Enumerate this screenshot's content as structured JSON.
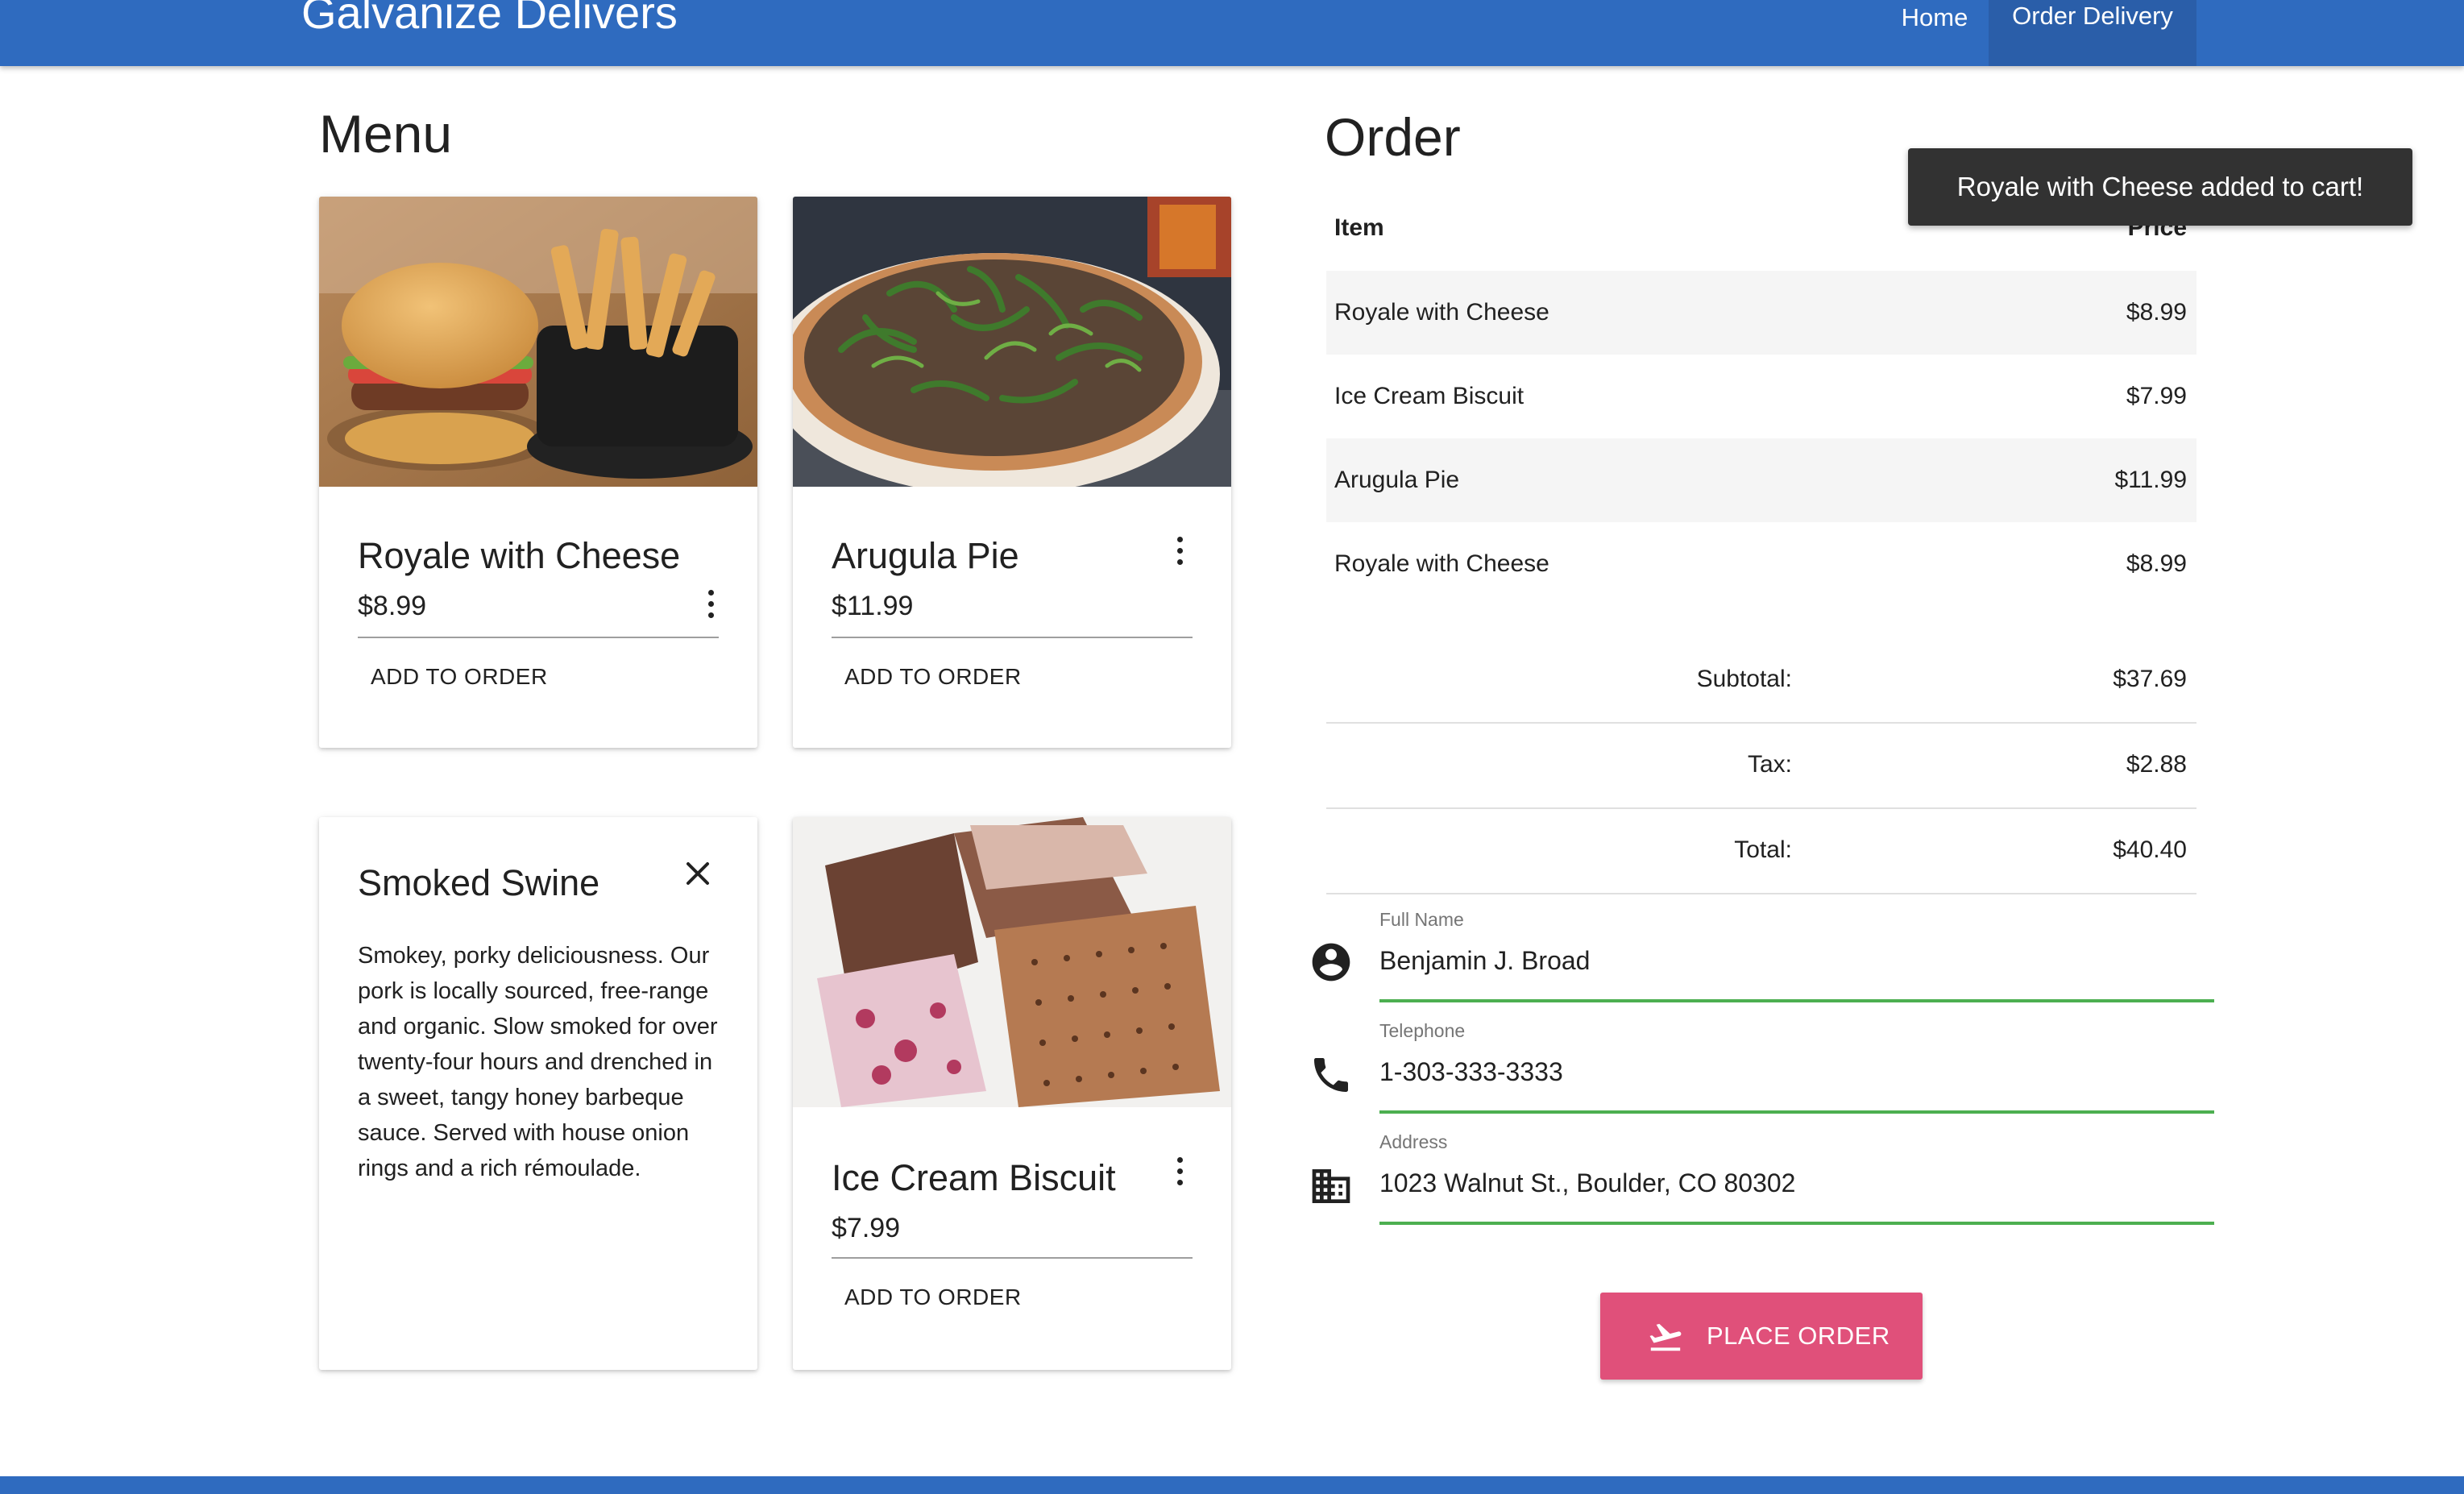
{
  "header": {
    "brand": "Galvanize Delivers",
    "nav": [
      {
        "label": "Home"
      },
      {
        "label": "Order Delivery"
      }
    ],
    "accent_color": "#2f6bbf"
  },
  "menu": {
    "title": "Menu",
    "items": [
      {
        "name": "Royale with Cheese",
        "price": "$8.99",
        "action": "ADD TO ORDER",
        "image": "burger-and-fries"
      },
      {
        "name": "Arugula Pie",
        "price": "$11.99",
        "action": "ADD TO ORDER",
        "image": "arugula-pizza"
      },
      {
        "name": "Smoked Swine",
        "description": "Smokey, porky deliciousness. Our pork is locally sourced, free-range and organic. Slow smoked for over twenty-four hours and drenched in a sweet, tangy honey barbeque sauce. Served with house onion rings and a rich rémoulade."
      },
      {
        "name": "Ice Cream Biscuit",
        "price": "$7.99",
        "action": "ADD TO ORDER",
        "image": "ice-cream-sandwiches"
      }
    ]
  },
  "order": {
    "title": "Order",
    "columns": {
      "item": "Item",
      "price": "Price"
    },
    "rows": [
      {
        "name": "Royale with Cheese",
        "price": "$8.99"
      },
      {
        "name": "Ice Cream Biscuit",
        "price": "$7.99"
      },
      {
        "name": "Arugula Pie",
        "price": "$11.99"
      },
      {
        "name": "Royale with Cheese",
        "price": "$8.99"
      }
    ],
    "summary": {
      "subtotal_label": "Subtotal:",
      "subtotal": "$37.69",
      "tax_label": "Tax:",
      "tax": "$2.88",
      "total_label": "Total:",
      "total": "$40.40"
    }
  },
  "form": {
    "name": {
      "label": "Full Name",
      "value": "Benjamin J. Broad",
      "icon": "account-circle-icon"
    },
    "phone": {
      "label": "Telephone",
      "value": "1-303-333-3333",
      "icon": "phone-icon"
    },
    "address": {
      "label": "Address",
      "value": "1023 Walnut St., Boulder, CO 80302",
      "icon": "business-icon"
    },
    "valid_color": "#4caf50"
  },
  "place_order": {
    "label": "PLACE ORDER",
    "icon": "flight-takeoff-icon",
    "color": "#e0507a"
  },
  "toast": {
    "message": "Royale with Cheese added to cart!"
  }
}
